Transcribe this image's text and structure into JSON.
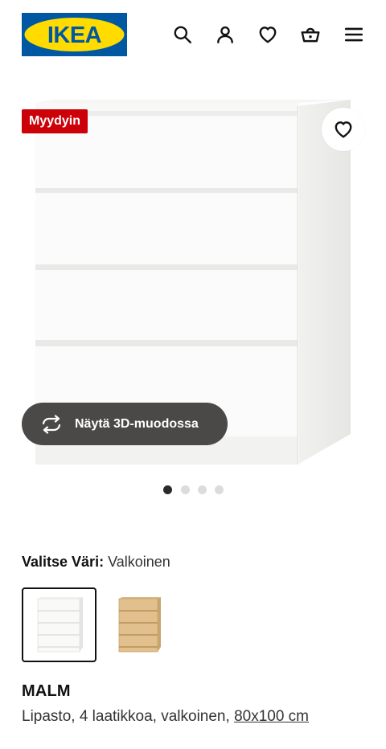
{
  "header": {
    "logo_text": "IKEA",
    "icons": [
      "search-icon",
      "account-icon",
      "heart-icon",
      "basket-icon",
      "menu-icon"
    ]
  },
  "gallery": {
    "badge": "Myydyin",
    "view_3d_label": "Näytä 3D-muodossa",
    "dots_total": 4,
    "dots_active_index": 0
  },
  "color_selector": {
    "label": "Valitse Väri:",
    "selected_value": "Valkoinen",
    "swatches": [
      {
        "name": "white",
        "selected": true
      },
      {
        "name": "oak",
        "selected": false
      }
    ]
  },
  "product": {
    "name": "MALM",
    "description": "Lipasto, 4 laatikkoa, valkoinen, ",
    "size": "80x100 cm"
  },
  "colors": {
    "logo_blue": "#0058a3",
    "logo_yellow": "#ffdb00",
    "badge_red": "#cc0008",
    "dark_button": "#4a4948"
  }
}
